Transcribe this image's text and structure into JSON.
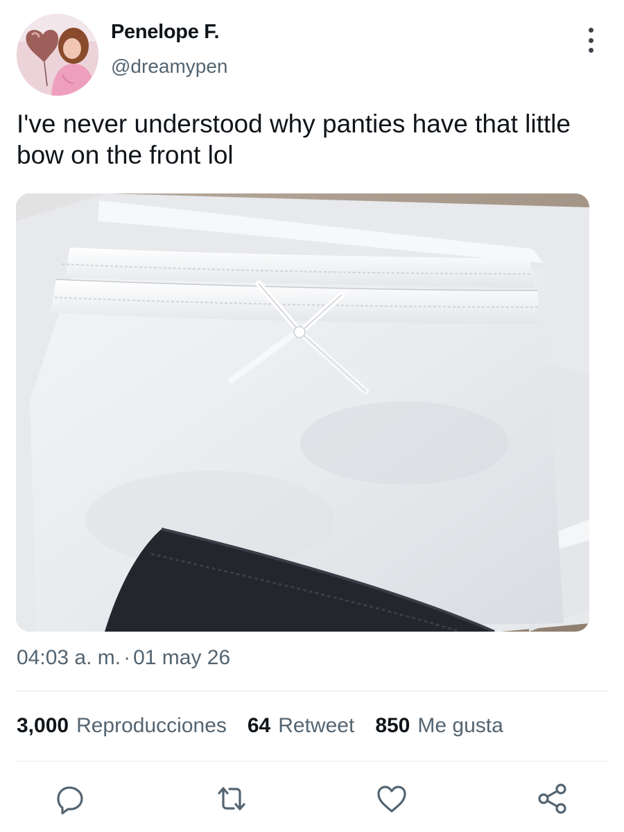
{
  "author": {
    "display_name": "Penelope F.",
    "handle": "@dreamypen",
    "avatar": "profile-photo"
  },
  "menu_icon": "more-vertical-icon",
  "tweet": {
    "text": "I've never understood why panties have that little bow on the front lol",
    "media": "photo-white-panties-with-bow"
  },
  "meta": {
    "time": "04:03 a. m.",
    "separator": "·",
    "date": "01 may 26"
  },
  "stats": {
    "views_count": "3,000",
    "views_label": "Reproducciones",
    "retweets_count": "64",
    "retweets_label": "Retweet",
    "likes_count": "850",
    "likes_label": "Me gusta"
  },
  "actions": [
    "reply-icon",
    "retweet-icon",
    "like-icon",
    "share-icon"
  ],
  "colors": {
    "text": "#0f1419",
    "secondary": "#536471",
    "divider": "#eff3f4",
    "icon": "#536471"
  }
}
